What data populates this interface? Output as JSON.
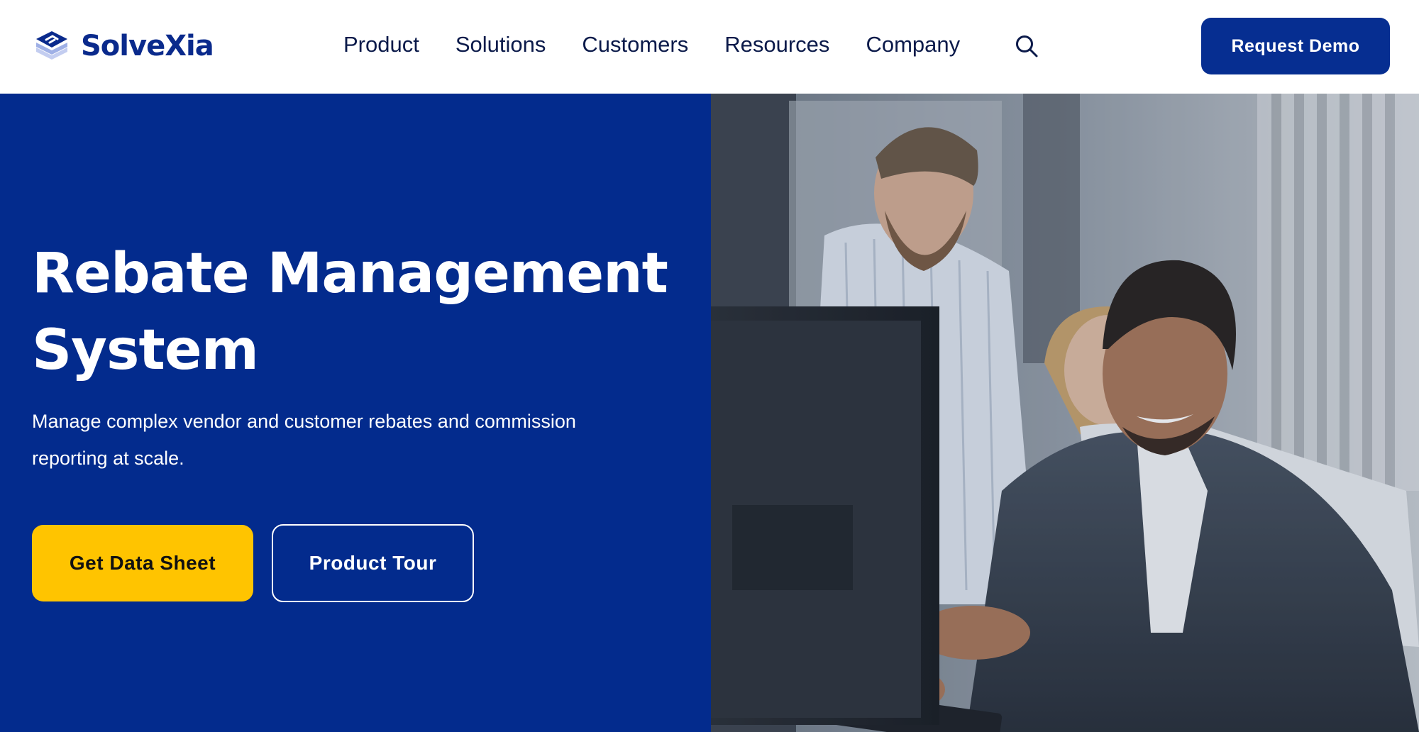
{
  "brand": {
    "name": "SolveXia",
    "primary_color": "#032b8d",
    "accent_color": "#ffc400",
    "logo_icon": "stacked-layers-logo-icon"
  },
  "nav": {
    "items": [
      {
        "label": "Product"
      },
      {
        "label": "Solutions"
      },
      {
        "label": "Customers"
      },
      {
        "label": "Resources"
      },
      {
        "label": "Company"
      }
    ],
    "search_icon": "search-icon"
  },
  "header": {
    "cta_label": "Request Demo"
  },
  "hero": {
    "title": "Rebate Management System",
    "subtitle": "Manage complex vendor and customer rebates and commission reporting at scale.",
    "primary_button": "Get Data Sheet",
    "secondary_button": "Product Tour",
    "image": "office-team-at-computer-photo"
  }
}
